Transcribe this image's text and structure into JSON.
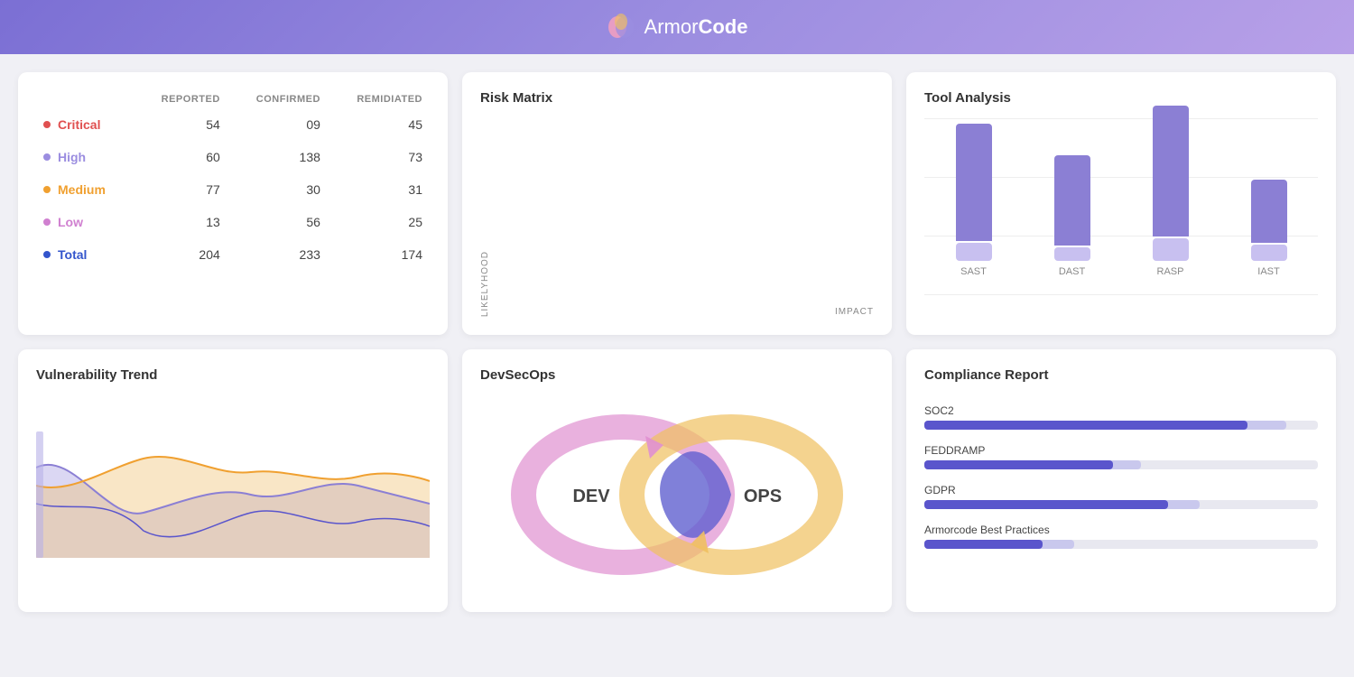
{
  "header": {
    "title_light": "Armor",
    "title_bold": "Code",
    "logo_colors": [
      "#f4a0c0",
      "#9b8de0",
      "#f0c060"
    ]
  },
  "vuln_table": {
    "headers": [
      "",
      "REPORTED",
      "CONFIRMED",
      "REMIDIATED"
    ],
    "rows": [
      {
        "label": "Critical",
        "color": "#e05050",
        "dot_color": "#e05050",
        "reported": "54",
        "confirmed": "09",
        "remidiated": "45"
      },
      {
        "label": "High",
        "color": "#9b8de0",
        "dot_color": "#9b8de0",
        "reported": "60",
        "confirmed": "138",
        "remidiated": "73"
      },
      {
        "label": "Medium",
        "color": "#f0a030",
        "dot_color": "#f0a030",
        "reported": "77",
        "confirmed": "30",
        "remidiated": "31"
      },
      {
        "label": "Low",
        "color": "#d080d0",
        "dot_color": "#d080d0",
        "reported": "13",
        "confirmed": "56",
        "remidiated": "25"
      },
      {
        "label": "Total",
        "color": "#3355cc",
        "dot_color": "#3355cc",
        "reported": "204",
        "confirmed": "233",
        "remidiated": "174"
      }
    ]
  },
  "risk_matrix": {
    "title": "Risk Matrix",
    "y_label": "LIKELYHOOD",
    "x_label": "IMPACT",
    "grid": [
      [
        "#c8c0e8",
        "#c8c0e8",
        "#e8c8b0",
        "#e8b0b0",
        "#e8b0b0"
      ],
      [
        "#c8c0e8",
        "#c8c0e8",
        "#e8c8b0",
        "#e8b0b0",
        "#e8b0b0"
      ],
      [
        "#e8d8a0",
        "#e8d8a0",
        "#e8d8a0",
        "#c8c0e8",
        "#c8c0e8"
      ],
      [
        "#e8c8a0",
        "#e8d8a0",
        "#e8d8a0",
        "#e8d8a0",
        "#c8c0e8"
      ],
      [
        "#e8c8b8",
        "#e8c8a0",
        "#e8d8a0",
        "#e8d8a0",
        "#c8c0e8"
      ]
    ]
  },
  "tool_analysis": {
    "title": "Tool Analysis",
    "bars": [
      {
        "label": "SAST",
        "primary_height": 130,
        "secondary_height": 20,
        "primary_color": "#8b7fd4",
        "secondary_color": "#c8c0f0"
      },
      {
        "label": "DAST",
        "primary_height": 100,
        "secondary_height": 15,
        "primary_color": "#8b7fd4",
        "secondary_color": "#c8c0f0"
      },
      {
        "label": "RASP",
        "primary_height": 145,
        "secondary_height": 25,
        "primary_color": "#8b7fd4",
        "secondary_color": "#c8c0f0"
      },
      {
        "label": "IAST",
        "primary_height": 70,
        "secondary_height": 18,
        "primary_color": "#8b7fd4",
        "secondary_color": "#c8c0f0"
      }
    ]
  },
  "vuln_trend": {
    "title": "Vulnerability Trend"
  },
  "devsecops": {
    "title": "DevSecOps",
    "dev_label": "DEV",
    "ops_label": "OPS"
  },
  "compliance": {
    "title": "Compliance Report",
    "items": [
      {
        "label": "SOC2",
        "primary": 82,
        "secondary": 92,
        "primary_color": "#5a55cc",
        "secondary_color": "#9b98e8"
      },
      {
        "label": "FEDDRAMP",
        "primary": 48,
        "secondary": 55,
        "primary_color": "#5a55cc",
        "secondary_color": "#9b98e8"
      },
      {
        "label": "GDPR",
        "primary": 62,
        "secondary": 70,
        "primary_color": "#5a55cc",
        "secondary_color": "#9b98e8"
      },
      {
        "label": "Armorcode Best Practices",
        "primary": 30,
        "secondary": 38,
        "primary_color": "#5a55cc",
        "secondary_color": "#9b98e8"
      }
    ]
  }
}
